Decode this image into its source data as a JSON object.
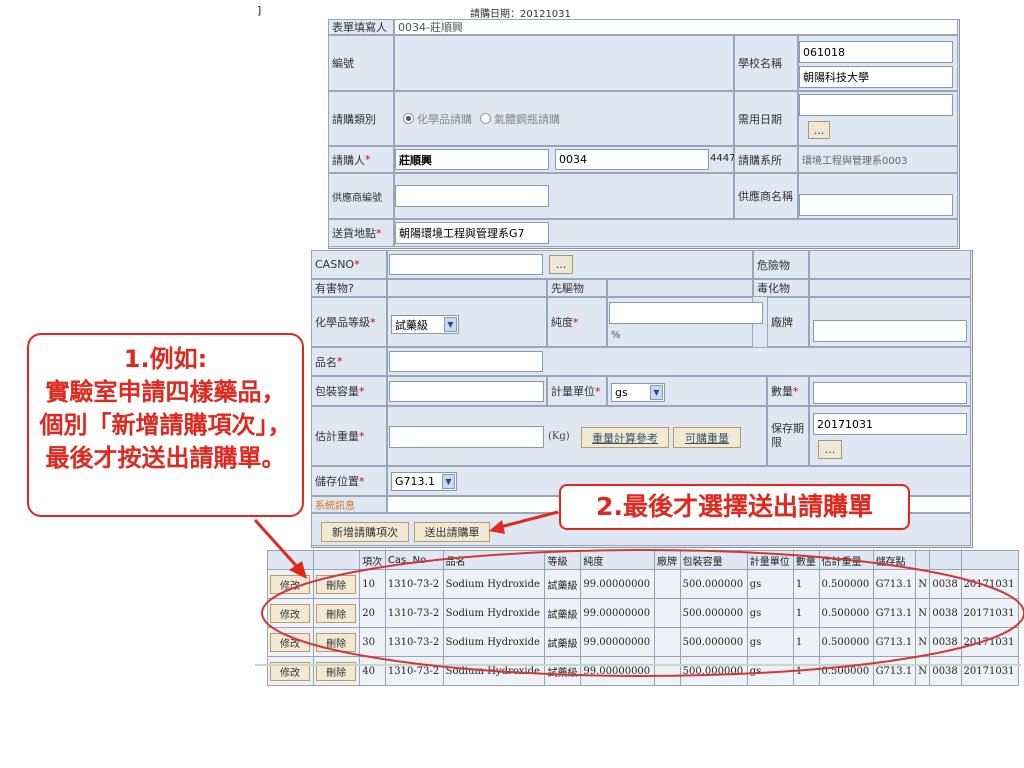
{
  "corner_mark": "]",
  "header": {
    "date_text": "請購日期：20121031"
  },
  "form": {
    "filler_label": "表單填寫人",
    "filler_value": "0034-莊順興",
    "number_label": "編號",
    "school_label": "學校名稱",
    "school_code": "061018",
    "school_name": "朝陽科技大學",
    "type_label": "請購類別",
    "type_option_chem": "化學品請購",
    "type_option_gas": "氣體鋼瓶請購",
    "need_date_label": "需用日期",
    "date_btn": "...",
    "requester_label": "請購人",
    "req_mark": "*",
    "requester_name": "莊順興",
    "requester_id": "0034",
    "requester_ext": "4447",
    "dept_label": "請購系所",
    "dept_value": "環境工程與管理系0003",
    "vendor_no_label": "供應商編號",
    "vendor_name_label": "供應商名稱",
    "delivery_label": "送貨地點",
    "delivery_value": "朝陽環境工程與管理系G7"
  },
  "item_form": {
    "casno_label": "CASNO",
    "dangerous_label": "危險物",
    "harmful_label": "有害物?",
    "precursor_label": "先驅物",
    "toxic_label": "毒化物",
    "grade_label": "化學品等級",
    "grade_value": "試藥級",
    "purity_label": "純度",
    "purity_unit": "%",
    "brand_label": "廠牌",
    "product_label": "品名",
    "package_label": "包裝容量",
    "unit_label": "計量單位",
    "unit_value": "gs",
    "qty_label": "數量",
    "est_weight_label": "估計重量",
    "kg_text": "(Kg)",
    "calc_ref_btn": "重量計算參考",
    "buyable_btn": "可購重量",
    "shelf_label": "保存期限",
    "shelf_value": "20171031",
    "storage_label": "儲存位置",
    "storage_value": "G713.1",
    "sys_msg_label": "系統訊息",
    "add_item_btn": "新增請購項次",
    "submit_btn": "送出請購單"
  },
  "item_table": {
    "headers": [
      "項次",
      "Cas. No",
      "品名",
      "等級",
      "純度",
      "廠牌",
      "包裝容量",
      "計量單位",
      "數量",
      "估計重量",
      "儲存點"
    ],
    "edit_label": "修改",
    "delete_label": "刪除",
    "rows": [
      [
        "10",
        "1310-73-2",
        "Sodium Hydroxide",
        "試藥級",
        "99.00000000",
        "",
        "500.000000",
        "gs",
        "1",
        "0.500000",
        "G713.1",
        "N",
        "0038",
        "20171031"
      ],
      [
        "20",
        "1310-73-2",
        "Sodium Hydroxide",
        "試藥級",
        "99.00000000",
        "",
        "500.000000",
        "gs",
        "1",
        "0.500000",
        "G713.1",
        "N",
        "0038",
        "20171031"
      ],
      [
        "30",
        "1310-73-2",
        "Sodium Hydroxide",
        "試藥級",
        "99.00000000",
        "",
        "500.000000",
        "gs",
        "1",
        "0.500000",
        "G713.1",
        "N",
        "0038",
        "20171031"
      ],
      [
        "40",
        "1310-73-2",
        "Sodium Hydroxide",
        "試藥級",
        "99.00000000",
        "",
        "500.000000",
        "gs",
        "1",
        "0.500000",
        "G713.1",
        "N",
        "0038",
        "20171031"
      ]
    ]
  },
  "annotations": {
    "callout1_title": "1.例如:",
    "callout1_body": "實驗室申請四樣藥品，個別「新增請購項次」，最後才按送出請購單。",
    "callout2": "2.最後才選擇送出請購單"
  },
  "colors": {
    "annotation_red": "#e0281e",
    "cell_bg": "#dfe7f3"
  }
}
